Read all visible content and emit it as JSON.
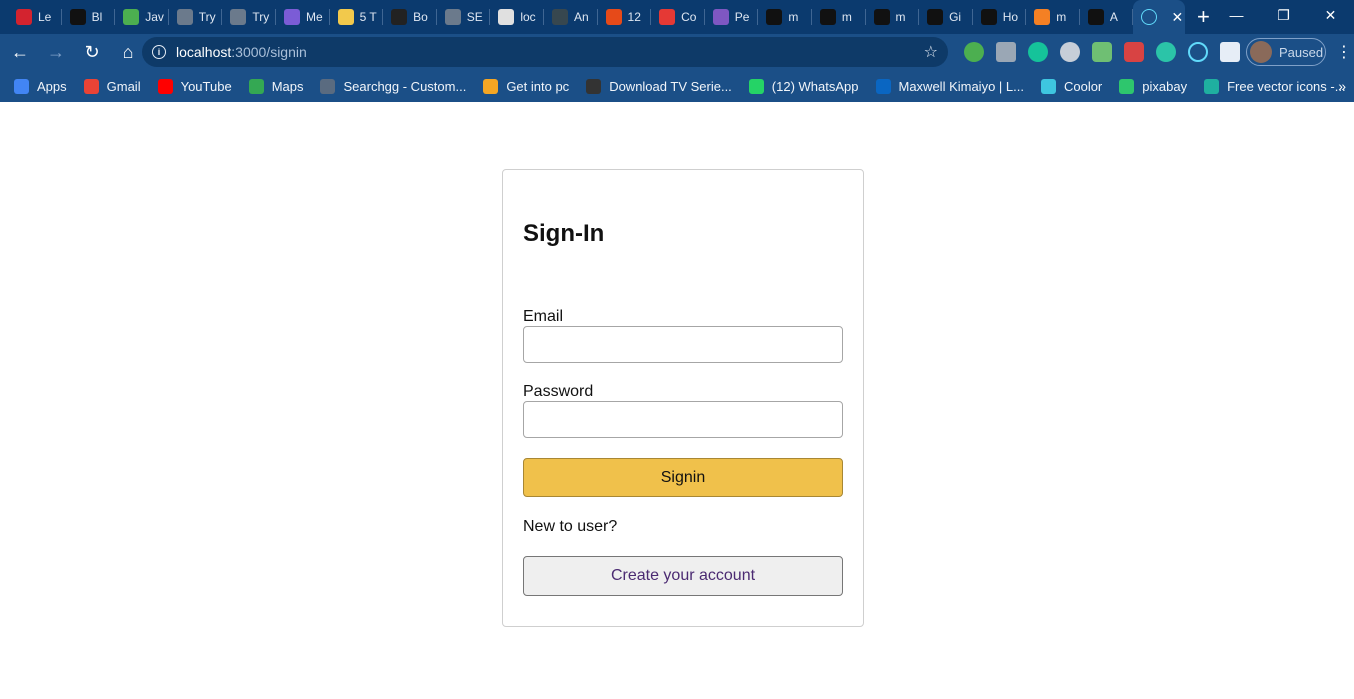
{
  "browser": {
    "tabs": [
      {
        "label": "Le",
        "color": "#d3232f"
      },
      {
        "label": "Bl",
        "color": "#111111"
      },
      {
        "label": "Jav",
        "color": "#4caf50"
      },
      {
        "label": "Try",
        "color": "#6b7a8c"
      },
      {
        "label": "Try",
        "color": "#6b7a8c"
      },
      {
        "label": "Me",
        "color": "#7b5cd6"
      },
      {
        "label": "5 T",
        "color": "#f2c94c"
      },
      {
        "label": "Bo",
        "color": "#222222"
      },
      {
        "label": "SE",
        "color": "#6b7a8c"
      },
      {
        "label": "loc",
        "color": "#e0e0e0"
      },
      {
        "label": "An",
        "color": "#37474f"
      },
      {
        "label": "12",
        "color": "#e64a19"
      },
      {
        "label": "Co",
        "color": "#e53935"
      },
      {
        "label": "Pe",
        "color": "#7e57c2"
      },
      {
        "label": "m",
        "color": "#111111"
      },
      {
        "label": "m",
        "color": "#111111"
      },
      {
        "label": "m",
        "color": "#111111"
      },
      {
        "label": "Gi",
        "color": "#111111"
      },
      {
        "label": "Ho",
        "color": "#111111"
      },
      {
        "label": "m",
        "color": "#f48024"
      },
      {
        "label": "A",
        "color": "#111111"
      }
    ],
    "active_tab_icon": "react-icon",
    "address": {
      "host": "localhost",
      "path": ":3000/signin"
    },
    "profile_label": "Paused",
    "bookmarks": [
      {
        "label": "Apps",
        "color": "#4285f4"
      },
      {
        "label": "Gmail",
        "color": "#ea4335"
      },
      {
        "label": "YouTube",
        "color": "#ff0000"
      },
      {
        "label": "Maps",
        "color": "#34a853"
      },
      {
        "label": "Searchgg - Custom...",
        "color": "#5a6b80"
      },
      {
        "label": "Get into pc",
        "color": "#f5a623"
      },
      {
        "label": "Download TV Serie...",
        "color": "#333333"
      },
      {
        "label": "(12) WhatsApp",
        "color": "#25d366"
      },
      {
        "label": "Maxwell Kimaiyo | L...",
        "color": "#0a66c2"
      },
      {
        "label": "Coolor",
        "color": "#3ec6e0"
      },
      {
        "label": "pixabay",
        "color": "#2ec66d"
      },
      {
        "label": "Free vector icons -...",
        "color": "#1fb0a0"
      }
    ]
  },
  "signin": {
    "title": "Sign-In",
    "email_label": "Email",
    "email_value": "",
    "password_label": "Password",
    "password_value": "",
    "submit_label": "Signin",
    "new_user_text": "New to user?",
    "create_label": "Create your account"
  }
}
